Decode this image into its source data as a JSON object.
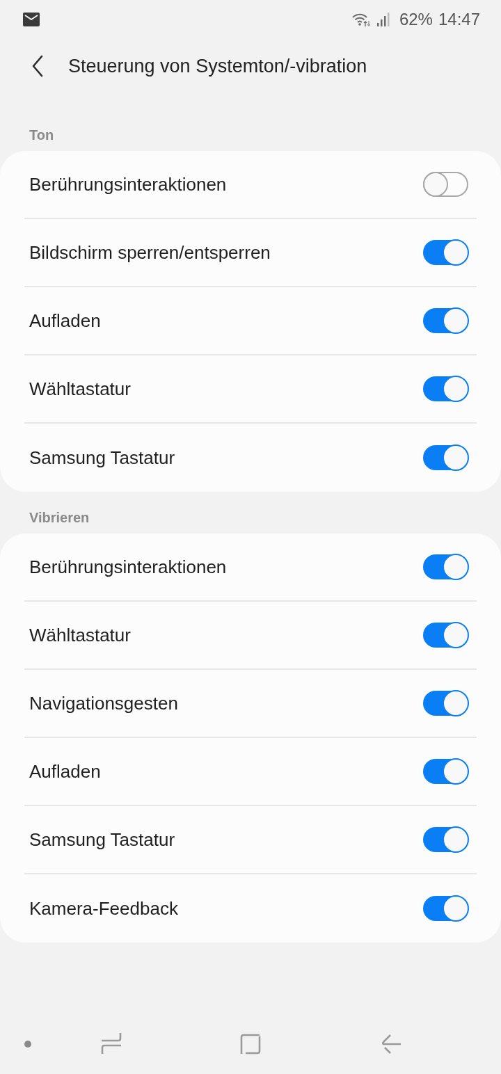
{
  "status_bar": {
    "battery": "62%",
    "time": "14:47"
  },
  "header": {
    "title": "Steuerung von Systemton/-vibration"
  },
  "sections": [
    {
      "label": "Ton",
      "items": [
        {
          "label": "Berührungsinteraktionen",
          "on": false
        },
        {
          "label": "Bildschirm sperren/entsperren",
          "on": true
        },
        {
          "label": "Aufladen",
          "on": true
        },
        {
          "label": "Wähltastatur",
          "on": true
        },
        {
          "label": "Samsung Tastatur",
          "on": true
        }
      ]
    },
    {
      "label": "Vibrieren",
      "items": [
        {
          "label": "Berührungsinteraktionen",
          "on": true
        },
        {
          "label": "Wähltastatur",
          "on": true
        },
        {
          "label": "Navigationsgesten",
          "on": true
        },
        {
          "label": "Aufladen",
          "on": true
        },
        {
          "label": "Samsung Tastatur",
          "on": true
        },
        {
          "label": "Kamera-Feedback",
          "on": true
        }
      ]
    }
  ]
}
